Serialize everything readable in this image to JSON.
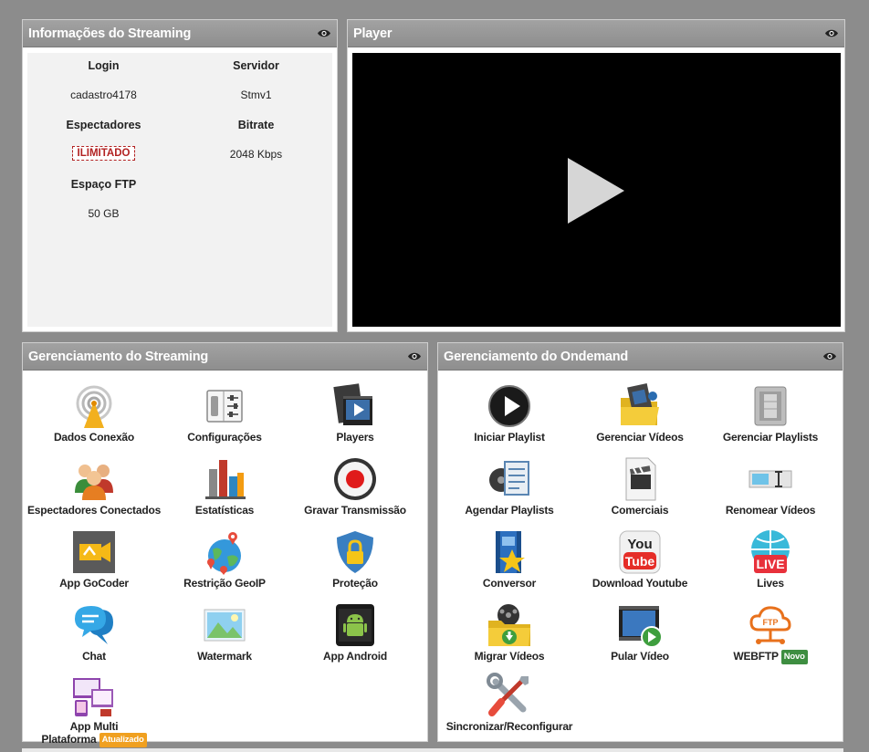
{
  "info_panel": {
    "title": "Informações do Streaming",
    "login_label": "Login",
    "login_value": "cadastro4178",
    "server_label": "Servidor",
    "server_value": "Stmv1",
    "viewers_label": "Espectadores",
    "viewers_value": "ILIMITADO",
    "bitrate_label": "Bitrate",
    "bitrate_value": "2048 Kbps",
    "ftp_label": "Espaço FTP",
    "ftp_value": "50 GB"
  },
  "player_panel": {
    "title": "Player"
  },
  "streaming_panel": {
    "title": "Gerenciamento do Streaming",
    "items": [
      {
        "label": "Dados Conexão",
        "icon": "antenna-icon"
      },
      {
        "label": "Configurações",
        "icon": "sliders-icon"
      },
      {
        "label": "Players",
        "icon": "film-player-icon"
      },
      {
        "label": "Espectadores Conectados",
        "icon": "people-icon"
      },
      {
        "label": "Estatísticas",
        "icon": "bar-chart-icon"
      },
      {
        "label": "Gravar Transmissão",
        "icon": "record-icon"
      },
      {
        "label": "App GoCoder",
        "icon": "gocoder-icon"
      },
      {
        "label": "Restrição GeoIP",
        "icon": "globe-pin-icon"
      },
      {
        "label": "Proteção",
        "icon": "shield-lock-icon"
      },
      {
        "label": "Chat",
        "icon": "chat-icon"
      },
      {
        "label": "Watermark",
        "icon": "image-icon"
      },
      {
        "label": "App Android",
        "icon": "android-icon"
      },
      {
        "label_line1": "App Multi",
        "label_line2": "Plataforma",
        "tag": "Atualizado",
        "icon": "multi-device-icon"
      }
    ]
  },
  "ondemand_panel": {
    "title": "Gerenciamento do Ondemand",
    "items": [
      {
        "label": "Iniciar Playlist",
        "icon": "play-circle-icon"
      },
      {
        "label": "Gerenciar Vídeos",
        "icon": "video-folder-icon"
      },
      {
        "label": "Gerenciar Playlists",
        "icon": "film-box-icon"
      },
      {
        "label": "Agendar Playlists",
        "icon": "schedule-reel-icon"
      },
      {
        "label": "Comerciais",
        "icon": "clapper-doc-icon"
      },
      {
        "label": "Renomear Vídeos",
        "icon": "rename-icon"
      },
      {
        "label": "Conversor",
        "icon": "converter-icon"
      },
      {
        "label": "Download Youtube",
        "icon": "youtube-icon"
      },
      {
        "label": "Lives",
        "icon": "live-icon"
      },
      {
        "label": "Migrar Vídeos",
        "icon": "migrate-folder-icon"
      },
      {
        "label": "Pular Vídeo",
        "icon": "skip-video-icon"
      },
      {
        "label": "WEBFTP",
        "tag": "Novo",
        "icon": "ftp-cloud-icon"
      },
      {
        "label": "Sincronizar/Reconfigurar",
        "icon": "tools-icon"
      }
    ]
  },
  "colors": {
    "background": "#8c8c8c",
    "header": "#999999",
    "badge_red": "#b22222",
    "tag_orange": "#f0a020",
    "tag_green": "#3e8e41"
  }
}
